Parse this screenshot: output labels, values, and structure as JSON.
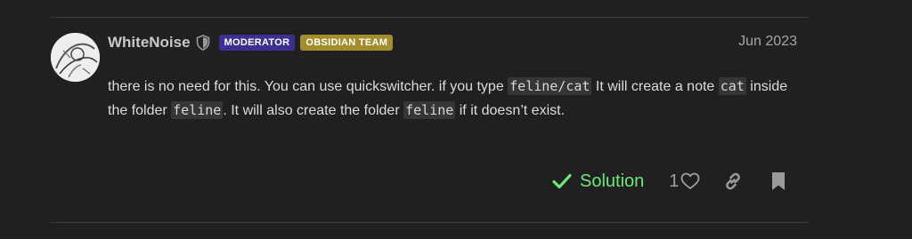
{
  "post": {
    "author": {
      "username": "WhiteNoise",
      "badges": [
        {
          "label": "MODERATOR",
          "color": "#3c2f94"
        },
        {
          "label": "OBSIDIAN TEAM",
          "color": "#a48d2c"
        }
      ]
    },
    "date": "Jun 2023",
    "body": {
      "t1": "there is no need for this. You can use quickswitcher. if you type ",
      "c1": "feline/cat",
      "t2": " It will create a note ",
      "c2": "cat",
      "t3": " inside the folder ",
      "c3": "feline",
      "t4": ". It will also create the folder ",
      "c4": "feline",
      "t5": " if it doesn’t exist."
    },
    "actions": {
      "solution_label": "Solution",
      "like_count": "1"
    }
  },
  "icons": {
    "shield": "shield-icon",
    "check": "check-icon",
    "heart": "heart-icon",
    "link": "link-icon",
    "bookmark": "bookmark-icon"
  },
  "colors": {
    "background": "#202020",
    "solution": "#6ce87b"
  }
}
